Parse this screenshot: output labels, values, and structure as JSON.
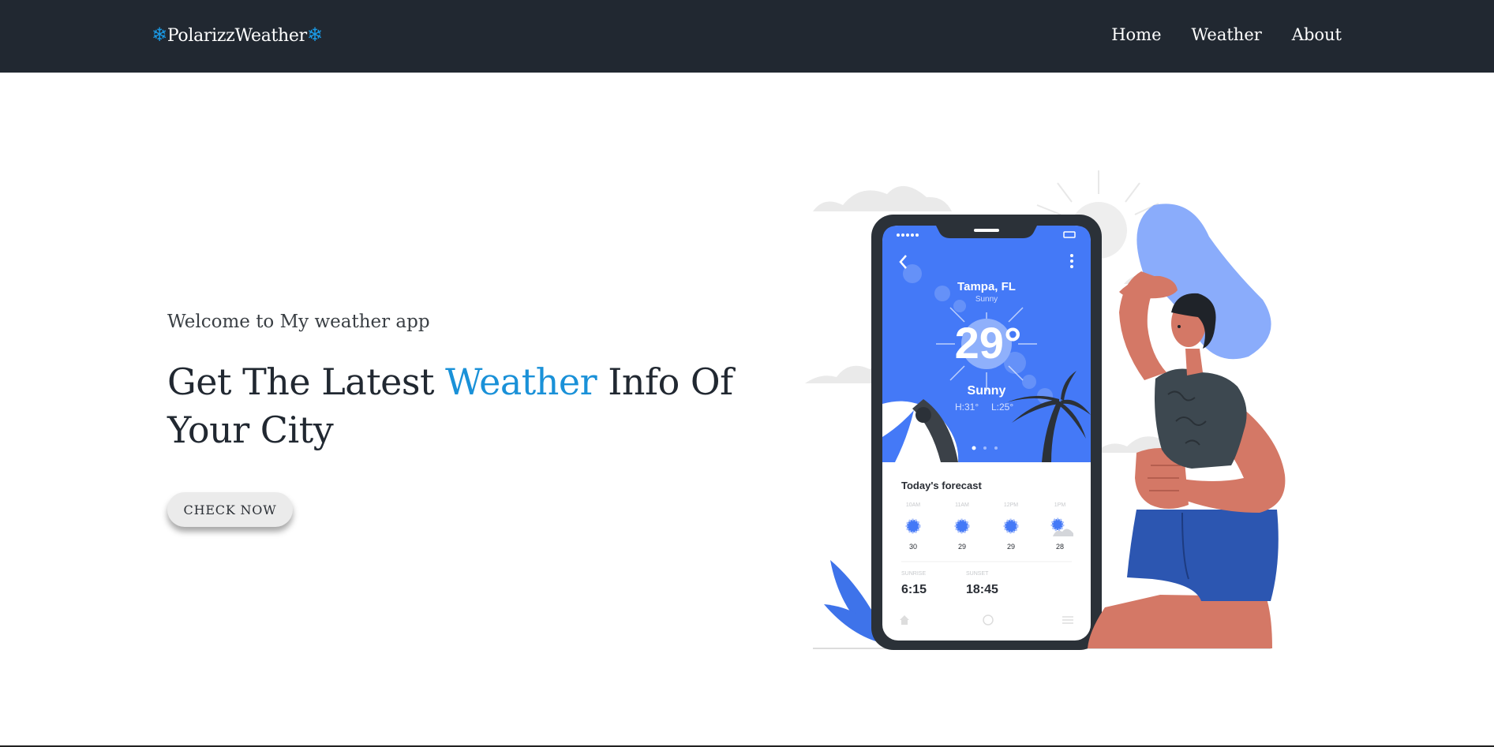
{
  "nav": {
    "brand": "❄️PolarizzWeather❄️",
    "brand_prefix": "❄",
    "brand_name": "PolarizzWeather",
    "brand_suffix": "❄",
    "links": [
      "Home",
      "Weather",
      "About"
    ]
  },
  "hero": {
    "welcome": "Welcome to My weather app",
    "headline_before": "Get The Latest ",
    "headline_accent": "Weather",
    "headline_after": " Info Of Your City",
    "button_label": "CHECK NOW"
  },
  "phone": {
    "city": "Tampa, FL",
    "condition_small": "Sunny",
    "temperature": "29°",
    "condition": "Sunny",
    "high": "H:31°",
    "low": "L:25°",
    "forecast_title": "Today's forecast",
    "forecast": [
      {
        "time": "10AM",
        "temp": "30",
        "icon": "sun-icon"
      },
      {
        "time": "11AM",
        "temp": "29",
        "icon": "sun-icon"
      },
      {
        "time": "12PM",
        "temp": "29",
        "icon": "sun-icon"
      },
      {
        "time": "1PM",
        "temp": "28",
        "icon": "sun-cloud-icon"
      }
    ],
    "sunrise_label": "SUNRISE",
    "sunrise": "6:15",
    "sunset_label": "SUNSET",
    "sunset": "18:45"
  },
  "colors": {
    "navbar": "#212831",
    "accent": "#1a91d8",
    "phone_screen": "#4479f7",
    "skin": "#d47866",
    "shorts": "#2c56b1"
  }
}
